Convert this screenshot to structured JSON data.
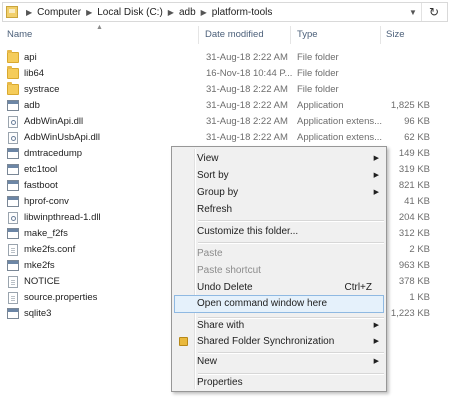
{
  "address": {
    "crumbs": [
      "Computer",
      "Local Disk (C:)",
      "adb",
      "platform-tools"
    ]
  },
  "columns": {
    "name": "Name",
    "date": "Date modified",
    "type": "Type",
    "size": "Size"
  },
  "files": [
    {
      "name": "api",
      "date": "31-Aug-18 2:22 AM",
      "type": "File folder",
      "size": "",
      "icon": "folder-icon"
    },
    {
      "name": "lib64",
      "date": "16-Nov-18 10:44 P...",
      "type": "File folder",
      "size": "",
      "icon": "folder-icon"
    },
    {
      "name": "systrace",
      "date": "31-Aug-18 2:22 AM",
      "type": "File folder",
      "size": "",
      "icon": "folder-icon"
    },
    {
      "name": "adb",
      "date": "31-Aug-18 2:22 AM",
      "type": "Application",
      "size": "1,825 KB",
      "icon": "app-icon"
    },
    {
      "name": "AdbWinApi.dll",
      "date": "31-Aug-18 2:22 AM",
      "type": "Application extens...",
      "size": "96 KB",
      "icon": "dll-icon"
    },
    {
      "name": "AdbWinUsbApi.dll",
      "date": "31-Aug-18 2:22 AM",
      "type": "Application extens...",
      "size": "62 KB",
      "icon": "dll-icon"
    },
    {
      "name": "dmtracedump",
      "date": "",
      "type": "",
      "size": "149 KB",
      "icon": "app-icon"
    },
    {
      "name": "etc1tool",
      "date": "",
      "type": "",
      "size": "319 KB",
      "icon": "app-icon"
    },
    {
      "name": "fastboot",
      "date": "",
      "type": "",
      "size": "821 KB",
      "icon": "app-icon"
    },
    {
      "name": "hprof-conv",
      "date": "",
      "type": "",
      "size": "41 KB",
      "icon": "app-icon"
    },
    {
      "name": "libwinpthread-1.dll",
      "date": "",
      "type": "",
      "size": "204 KB",
      "icon": "dll-icon"
    },
    {
      "name": "make_f2fs",
      "date": "",
      "type": "",
      "size": "312 KB",
      "icon": "app-icon"
    },
    {
      "name": "mke2fs.conf",
      "date": "",
      "type": "",
      "size": "2 KB",
      "icon": "doc-icon"
    },
    {
      "name": "mke2fs",
      "date": "",
      "type": "",
      "size": "963 KB",
      "icon": "app-icon"
    },
    {
      "name": "NOTICE",
      "date": "",
      "type": "",
      "size": "378 KB",
      "icon": "doc-icon"
    },
    {
      "name": "source.properties",
      "date": "",
      "type": "",
      "size": "1 KB",
      "icon": "doc-icon"
    },
    {
      "name": "sqlite3",
      "date": "",
      "type": "",
      "size": "1,223 KB",
      "icon": "app-icon"
    }
  ],
  "menu": {
    "view": "View",
    "sort_by": "Sort by",
    "group_by": "Group by",
    "refresh": "Refresh",
    "customize": "Customize this folder...",
    "paste": "Paste",
    "paste_shortcut": "Paste shortcut",
    "undo_delete": "Undo Delete",
    "undo_shortcut": "Ctrl+Z",
    "open_cmd": "Open command window here",
    "share_with": "Share with",
    "shared_sync": "Shared Folder Synchronization",
    "new": "New",
    "properties": "Properties"
  }
}
